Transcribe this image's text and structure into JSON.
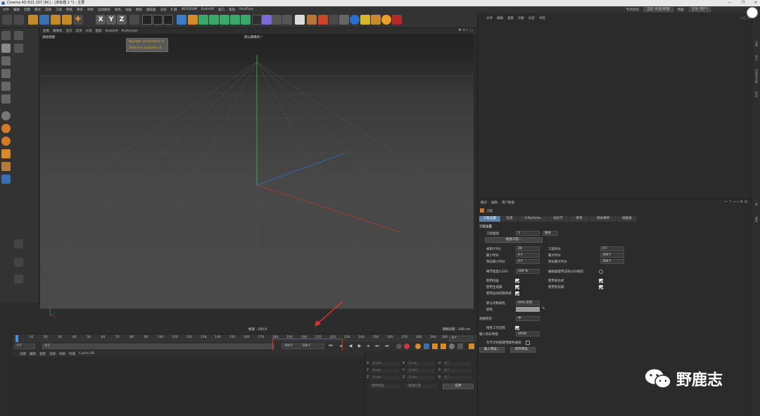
{
  "window": {
    "title": "Cinema 4D R21.207 (RC) - [未标题 1 *] - 主要",
    "controls": [
      "—",
      "❐",
      "✕"
    ]
  },
  "menubar": {
    "items": [
      "文件",
      "编辑",
      "创建",
      "模式",
      "选择",
      "工具",
      "网格",
      "样条",
      "体积",
      "运动图形",
      "角色",
      "动画",
      "模拟",
      "跟踪器",
      "渲染",
      "扩展",
      "INSYDIUM",
      "Redshift",
      "窗口",
      "帮助",
      "RealFlow"
    ],
    "node_space_label": "节点空间:",
    "node_space_value": "当前 (标准/物理)",
    "interface_label": "界面:",
    "interface_value": "启动 (用户)"
  },
  "toolbar": {
    "axis_labels": [
      "X",
      "Y",
      "Z"
    ]
  },
  "viewport": {
    "menu": [
      "查看",
      "摄像机",
      "显示",
      "选项",
      "过滤",
      "面板",
      "Redshift",
      "ProRender"
    ],
    "view_name": "透视视图",
    "camera_name": "默认摄像机 *",
    "hud": {
      "emitters": "Number of emitters: 0",
      "particles": "Total live particles: 0"
    },
    "speed": "帧速 : 200.0",
    "grid_spacing": "网格间距 : 100 cm"
  },
  "timeline": {
    "ticks": [
      "0",
      "10",
      "20",
      "30",
      "40",
      "50",
      "60",
      "70",
      "80",
      "90",
      "100",
      "110",
      "120",
      "130",
      "140",
      "150",
      "160",
      "170",
      "180",
      "190",
      "200",
      "210",
      "220",
      "230",
      "240",
      "250",
      "260",
      "270",
      "280",
      "290",
      "300"
    ],
    "end_frame": "0 F"
  },
  "transport": {
    "current_frame": "0 F",
    "start_frame": "0 F",
    "max_frame_a": "300 F",
    "max_frame_b": "300 F"
  },
  "material_menu": [
    "创建",
    "编辑",
    "查看",
    "选择",
    "材质",
    "纹理",
    "Cycles 4D"
  ],
  "coordinates": {
    "rows": [
      {
        "axis": "X",
        "pos": "0 cm",
        "axis2": "X",
        "size": "0 cm",
        "axis3": "H",
        "rot": "0 °"
      },
      {
        "axis": "Y",
        "pos": "0 cm",
        "axis2": "Y",
        "size": "0 cm",
        "axis3": "P",
        "rot": "0 °"
      },
      {
        "axis": "Z",
        "pos": "0 cm",
        "axis2": "Z",
        "size": "0 cm",
        "axis3": "B",
        "rot": "0 °"
      }
    ],
    "mode_a": "世界坐标",
    "mode_b": "缩放比例",
    "apply": "应用"
  },
  "object_manager": {
    "menu": [
      "文件",
      "编辑",
      "查看",
      "对象",
      "标签",
      "书签"
    ]
  },
  "attributes": {
    "menu": [
      "模式",
      "编辑",
      "用户数据"
    ],
    "object_title": "工程",
    "tabs": [
      "工程设置",
      "信息",
      "X-Particles",
      "动力学",
      "参考",
      "待办事项",
      "帧插值"
    ],
    "section": "工程设置",
    "scale_label": "工程缩放",
    "scale_value": "1",
    "scale_unit": "厘米",
    "scale_button": "缩放工程...",
    "fps_label": "帧率(FPS)",
    "fps_value": "30",
    "project_time_label": "工程时长",
    "project_time_value": "0 F",
    "min_time_label": "最小时长",
    "min_time_value": "0 F",
    "max_time_label": "最大时长",
    "max_time_value": "300 F",
    "preview_min_label": "预览最小时长",
    "preview_min_value": "0 F",
    "preview_max_label": "预览最大时长",
    "preview_max_value": "300 F",
    "lod_label": "细节程度(LOD)",
    "lod_value": "100 %",
    "lod_editor_label": "编辑器使用渲染LOD级别",
    "use_anim_label": "使用动画",
    "use_expr_label": "使用表达式",
    "use_gen_label": "使用生成器",
    "use_deform_label": "使用变形器",
    "use_motion_label": "使用运动剪辑系统",
    "default_color_label": "默认对象颜色",
    "default_color_value": "60% 灰色",
    "color_label": "颜色",
    "view_clip_label": "视图修剪",
    "view_clip_value": "中",
    "linear_label": "线性工作流程",
    "input_color_label": "输入色彩特性",
    "input_color_value": "sRGB",
    "node_color_label": "为节点材质使用颜色通道",
    "load_button": "载入预设...",
    "save_button": "保存预设..."
  },
  "side_tabs": [
    "对象",
    "场次",
    "内容浏览器",
    "构造",
    "层",
    "属性"
  ],
  "watermark": {
    "text": "野鹿志"
  }
}
